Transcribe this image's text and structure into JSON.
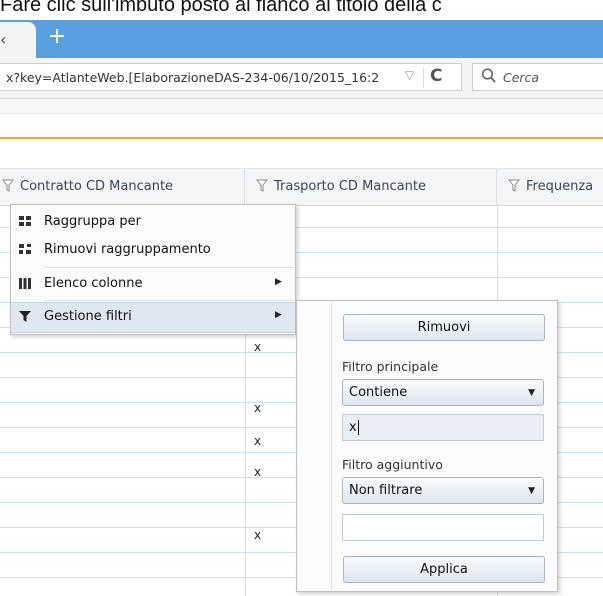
{
  "caption_fragment": "Fare clic sull'imbuto posto al fianco al titolo della c",
  "browser": {
    "tab_fragment": "‹",
    "new_tab": "+",
    "url": "x?key=AtlanteWeb.[ElaborazioneDAS-234-06/10/2015_16:2",
    "search_placeholder": "Cerca"
  },
  "grid": {
    "columns": [
      {
        "label": "Contratto CD Mancante"
      },
      {
        "label": "Trasporto CD Mancante"
      },
      {
        "label": "Frequenza"
      }
    ],
    "cell_marker": "x"
  },
  "context_menu": {
    "items": [
      {
        "label": "Raggruppa per",
        "icon": "group-icon"
      },
      {
        "label": "Rimuovi raggruppamento",
        "icon": "ungroup-icon"
      },
      {
        "label": "Elenco colonne",
        "icon": "columns-icon",
        "submenu": true
      },
      {
        "label": "Gestione filtri",
        "icon": "filter-icon",
        "submenu": true,
        "active": true
      }
    ]
  },
  "filter_panel": {
    "remove_label": "Rimuovi",
    "main_filter_label": "Filtro principale",
    "main_filter_value": "Contiene",
    "main_filter_text": "x",
    "extra_filter_label": "Filtro aggiuntivo",
    "extra_filter_value": "Non filtrare",
    "extra_filter_text": "",
    "apply_label": "Applica"
  },
  "colors": {
    "tabbar": "#59a0e1",
    "accent_line": "#f6a623",
    "grid_lines": "#c7e3f1"
  }
}
